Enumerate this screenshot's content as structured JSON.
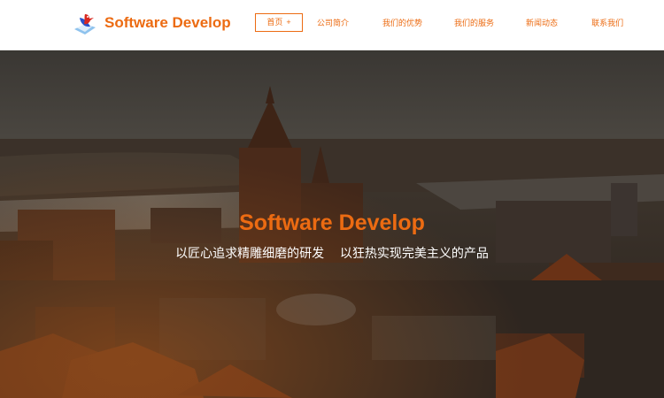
{
  "brand": {
    "name": "Software Develop",
    "logo_icon": "bird-logo-icon",
    "accent_color": "#ec6b12"
  },
  "nav": {
    "items": [
      {
        "label": "首页",
        "suffix": "+"
      },
      {
        "label": "公司简介"
      },
      {
        "label": "我们的优势"
      },
      {
        "label": "我们的服务"
      },
      {
        "label": "新闻动态"
      },
      {
        "label": "联系我们"
      }
    ]
  },
  "hero": {
    "title": "Software Develop",
    "subtitle": "以匠心追求精雕细磨的研发    以狂热实现完美主义的产品"
  }
}
